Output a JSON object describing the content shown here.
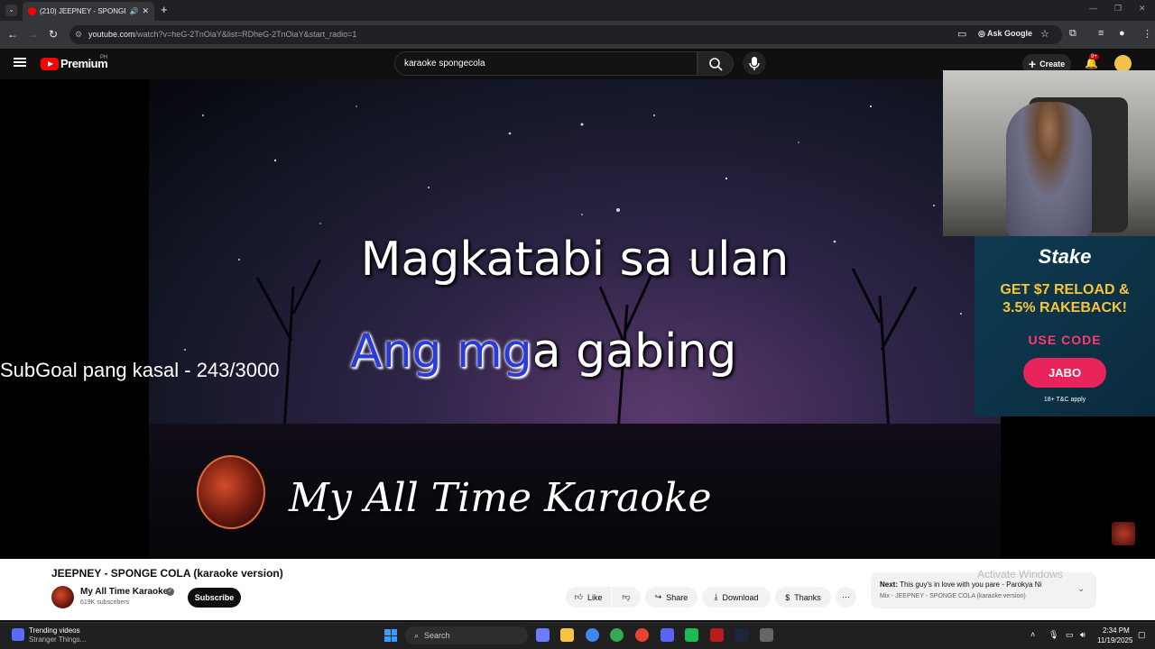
{
  "browser": {
    "tab_title": "(210) JEEPNEY - SPONGE C",
    "url_host": "youtube.com",
    "url_path": "/watch?v=heG-2TnOiaY&list=RDheG-2TnOiaY&start_radio=1",
    "ask_google": "Ask Google"
  },
  "youtube": {
    "brand": "Premium",
    "region": "PH",
    "search_query": "karaoke spongecola",
    "create_label": "Create",
    "notif_badge": "9+"
  },
  "video": {
    "lyric_line1": "Magkatabi sa ulan",
    "lyric_line2_highlight": "Ang mg",
    "lyric_line2_rest": "a gabing",
    "watermark": "My All Time Karaoke",
    "subgoal": "SubGoal pang kasal - 243/3000"
  },
  "ad": {
    "brand": "Stake",
    "headline": "GET $7 RELOAD & 3.5% RAKEBACK!",
    "use_code": "USE CODE",
    "code": "JABO",
    "terms": "18+  T&C apply"
  },
  "info": {
    "title": "JEEPNEY - SPONGE COLA (karaoke version)",
    "channel": "My All Time Karaoke",
    "subscribers": "619K subscribers",
    "subscribe": "Subscribe",
    "like": "Like",
    "share": "Share",
    "download": "Download",
    "thanks": "Thanks",
    "next_label": "Next:",
    "next_title": "This guy's in love with you pare - Parokya Ni E...",
    "next_sub": "Mix - JEEPNEY - SPONGE COLA (karaoke version)",
    "activate": "Activate Windows"
  },
  "taskbar": {
    "trend_title": "Trending videos",
    "trend_sub": "Stranger Things...",
    "search_placeholder": "Search",
    "time": "2:34 PM",
    "date": "11/19/2025"
  },
  "colors": {
    "yt_red": "#ff0000",
    "lyric_highlight": "#2a3bd6",
    "ad_accent": "#e8245a",
    "ad_headline": "#f7c535"
  }
}
